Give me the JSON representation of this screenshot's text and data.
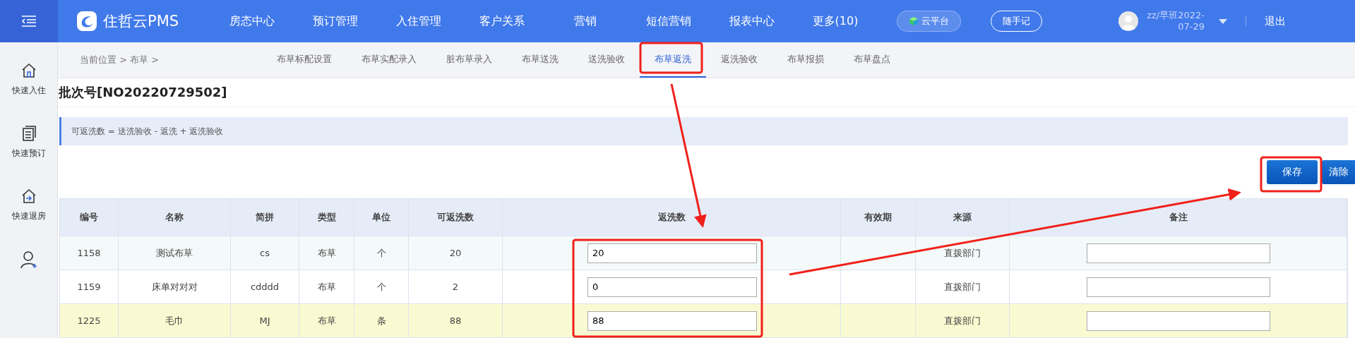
{
  "top_bar": {
    "brand": "住哲云PMS",
    "menu": [
      "房态中心",
      "预订管理",
      "入住管理",
      "客户关系",
      "营销",
      "短信营销",
      "报表中心",
      "更多(10)"
    ],
    "cloud_button": "云平台",
    "notes_button": "随手记",
    "user": {
      "name": "zz/早班2022-",
      "date": "07-29"
    },
    "logout": "退出"
  },
  "sidebar": {
    "items": [
      {
        "kind": "checkin",
        "label": "快速入住"
      },
      {
        "kind": "booking",
        "label": "快速预订"
      },
      {
        "kind": "checkout",
        "label": "快速退房"
      },
      {
        "kind": "guest"
      }
    ]
  },
  "breadcrumb": "当前位置 > 布草 >",
  "tabs": [
    {
      "label": "布草标配设置",
      "selected": false
    },
    {
      "label": "布草实配录入",
      "selected": false
    },
    {
      "label": "脏布草录入",
      "selected": false
    },
    {
      "label": "布草送洗",
      "selected": false
    },
    {
      "label": "送洗验收",
      "selected": false
    },
    {
      "label": "布草返洗",
      "selected": true
    },
    {
      "label": "返洗验收",
      "selected": false
    },
    {
      "label": "布草报损",
      "selected": false
    },
    {
      "label": "布草盘点",
      "selected": false
    }
  ],
  "batch_title": "批次号[NO20220729502]",
  "formula": "可返洗数 = 送洗验收 - 返洗 + 返洗验收",
  "buttons": [
    {
      "label": "保存",
      "kind": "primary"
    },
    {
      "label": "清除",
      "kind": "secondary"
    }
  ],
  "table": {
    "columns": [
      "编号",
      "名称",
      "简拼",
      "类型",
      "单位",
      "可返洗数",
      "返洗数",
      "有效期",
      "来源",
      "备注"
    ],
    "rows": [
      {
        "id": "1158",
        "name": "测试布草",
        "pinyin": "cs",
        "type": "布草",
        "unit": "个",
        "available": "20",
        "return_qty": "20",
        "source": "直拨部门",
        "highlighted": false
      },
      {
        "id": "1159",
        "name": "床单对对对",
        "pinyin": "cdddd",
        "type": "布草",
        "unit": "个",
        "available": "2",
        "return_qty": "0",
        "source": "直拨部门",
        "highlighted": false
      },
      {
        "id": "1225",
        "name": "毛巾",
        "pinyin": "MJ",
        "type": "布草",
        "unit": "条",
        "available": "88",
        "return_qty": "88",
        "source": "直拨部门",
        "highlighted": true
      }
    ]
  }
}
